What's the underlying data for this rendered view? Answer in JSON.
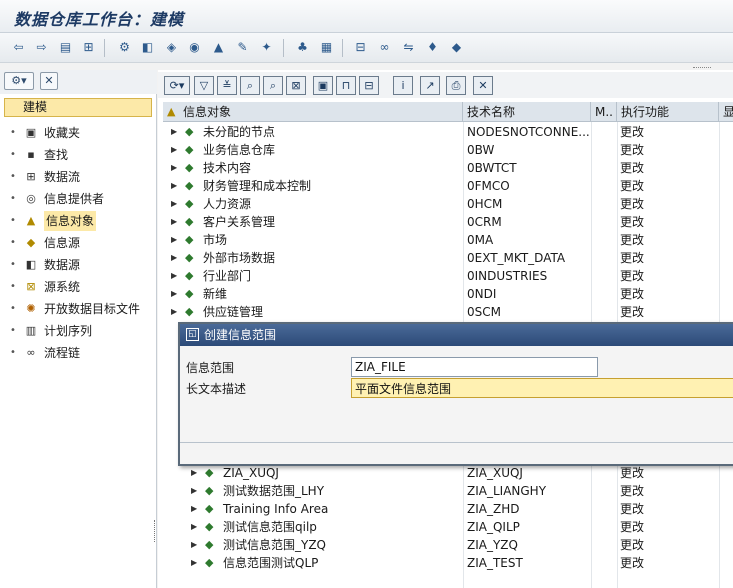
{
  "window": {
    "title": "数据仓库工作台：建模"
  },
  "left_pane": {
    "section": "建模",
    "items": [
      {
        "label": "收藏夹",
        "icon": "favorites-icon"
      },
      {
        "label": "查找",
        "icon": "find-icon"
      },
      {
        "label": "数据流",
        "icon": "dataflow-icon"
      },
      {
        "label": "信息提供者",
        "icon": "infoprovider-icon"
      },
      {
        "label": "信息对象",
        "icon": "infoobject-icon",
        "selected": true
      },
      {
        "label": "信息源",
        "icon": "infosource-icon"
      },
      {
        "label": "数据源",
        "icon": "datasource-icon"
      },
      {
        "label": "源系统",
        "icon": "source-system-icon"
      },
      {
        "label": "开放数据目标文件",
        "icon": "open-hub-icon"
      },
      {
        "label": "计划序列",
        "icon": "schedule-icon"
      },
      {
        "label": "流程链",
        "icon": "process-chain-icon"
      }
    ]
  },
  "grid": {
    "columns": [
      "信息对象",
      "技术名称",
      "M..",
      "执行功能",
      "显"
    ],
    "rows_top": [
      {
        "name": "未分配的节点",
        "tech": "NODESNOTCONNE...",
        "func": "更改"
      },
      {
        "name": "业务信息仓库",
        "tech": "0BW",
        "func": "更改"
      },
      {
        "name": "技术内容",
        "tech": "0BWTCT",
        "func": "更改"
      },
      {
        "name": "财务管理和成本控制",
        "tech": "0FMCO",
        "func": "更改"
      },
      {
        "name": "人力资源",
        "tech": "0HCM",
        "func": "更改"
      },
      {
        "name": "客户关系管理",
        "tech": "0CRM",
        "func": "更改"
      },
      {
        "name": "市场",
        "tech": "0MA",
        "func": "更改"
      },
      {
        "name": "外部市场数据",
        "tech": "0EXT_MKT_DATA",
        "func": "更改"
      },
      {
        "name": "行业部门",
        "tech": "0INDUSTRIES",
        "func": "更改"
      },
      {
        "name": "新维",
        "tech": "0NDI",
        "func": "更改"
      },
      {
        "name": "供应链管理",
        "tech": "0SCM",
        "func": "更改"
      }
    ],
    "rows_bottom": [
      {
        "name": "ZIA_XUQJ",
        "tech": "ZIA_XUQJ",
        "func": "更改"
      },
      {
        "name": "测试数据范围_LHY",
        "tech": "ZIA_LIANGHY",
        "func": "更改"
      },
      {
        "name": "Training Info Area",
        "tech": "ZIA_ZHD",
        "func": "更改"
      },
      {
        "name": "测试信息范围qilp",
        "tech": "ZIA_QILP",
        "func": "更改"
      },
      {
        "name": "测试信息范围_YZQ",
        "tech": "ZIA_YZQ",
        "func": "更改"
      },
      {
        "name": "信息范围测试QLP",
        "tech": "ZIA_TEST",
        "func": "更改"
      }
    ]
  },
  "dialog": {
    "title": "创建信息范围",
    "fields": [
      {
        "label": "信息范围",
        "value": "ZIA_FILE"
      },
      {
        "label": "长文本描述",
        "value": "平面文件信息范围"
      }
    ]
  }
}
